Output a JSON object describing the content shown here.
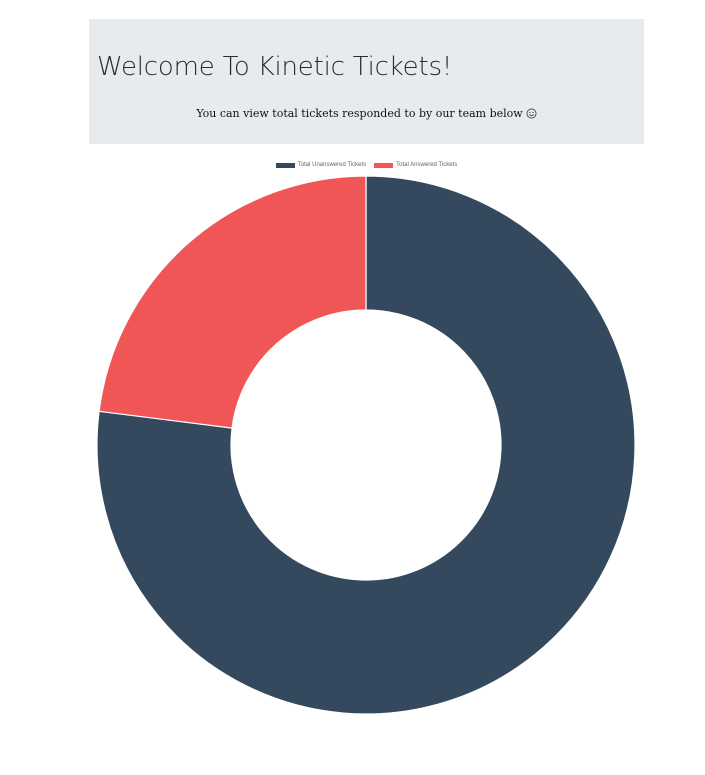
{
  "header": {
    "title": "Welcome To Kinetic Tickets!",
    "subtitle": "You can view total tickets responded to by our team below"
  },
  "colors": {
    "unanswered": "#34485e",
    "answered": "#f05656",
    "header_bg": "#e8ebee"
  },
  "chart_data": {
    "type": "doughnut",
    "title": "",
    "legend_position": "top",
    "labels": [
      "Total Unanswered Tickets",
      "Total Answered Tickets"
    ],
    "values": [
      77,
      23
    ],
    "colors": [
      "#34485e",
      "#f05656"
    ]
  }
}
